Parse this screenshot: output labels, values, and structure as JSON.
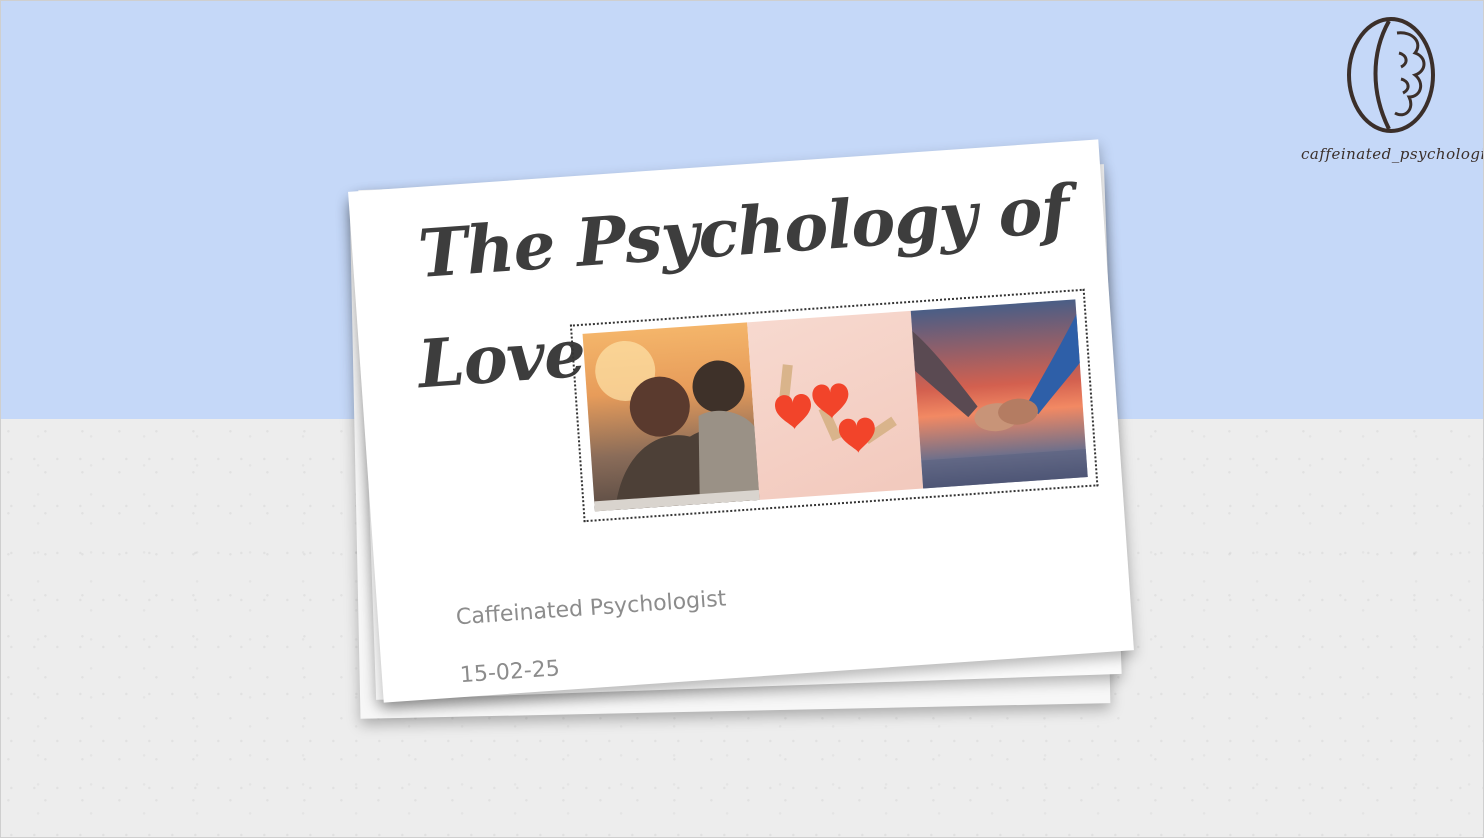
{
  "slide": {
    "title_line_1": "The Psychology of",
    "title_line_2": "Love",
    "author": "Caffeinated Psychologist",
    "date": "15-02-25"
  },
  "logo": {
    "icon": "brain-coffee-bean-icon",
    "text": "caffeinated_psychologist"
  },
  "images": [
    {
      "name": "couple-sunset-photo"
    },
    {
      "name": "hearts-clothespins-photo"
    },
    {
      "name": "holding-hands-photo"
    }
  ],
  "colors": {
    "sky": "#c5d8f8",
    "floor": "#ededed",
    "title": "#3d3d3d",
    "subtitle": "#8c8c8c",
    "logo": "#3b2f2a"
  }
}
